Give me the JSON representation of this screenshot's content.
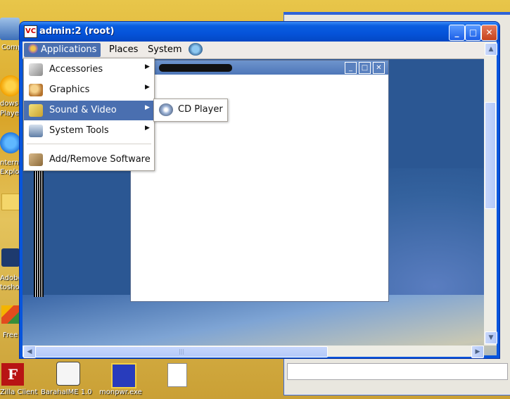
{
  "desktop": {
    "left_labels": [
      "Comp",
      "dows",
      "Playe",
      "nterne",
      "Explore",
      "Adobe",
      "toshop",
      "Free"
    ],
    "bottom_icons": [
      "Zilla Client",
      "BarahaIME 1.0",
      "monpwr.exe"
    ]
  },
  "window": {
    "title": "admin:2 (root)",
    "logo": "VC",
    "buttons": {
      "minimize": "_",
      "maximize": "□",
      "close": "✕"
    }
  },
  "panel": {
    "menus": [
      "Applications",
      "Places",
      "System"
    ]
  },
  "applications_menu": {
    "items": [
      {
        "label": "Accessories",
        "has_submenu": true,
        "icon": "accessories-icon"
      },
      {
        "label": "Graphics",
        "has_submenu": true,
        "icon": "graphics-icon"
      },
      {
        "label": "Sound & Video",
        "has_submenu": true,
        "icon": "sound-video-icon",
        "highlighted": true
      },
      {
        "label": "System Tools",
        "has_submenu": true,
        "icon": "system-tools-icon"
      },
      {
        "label": "Add/Remove Software",
        "has_submenu": false,
        "icon": "add-remove-software-icon"
      }
    ]
  },
  "submenu": {
    "items": [
      {
        "label": "CD Player",
        "icon": "cd-player-icon"
      }
    ]
  },
  "scrollbar": {
    "hgrip": "|||"
  },
  "colors": {
    "xp_title_blue": "#0553d9",
    "gnome_highlight": "#4a6fb0",
    "panel_bg": "#efebe7"
  }
}
